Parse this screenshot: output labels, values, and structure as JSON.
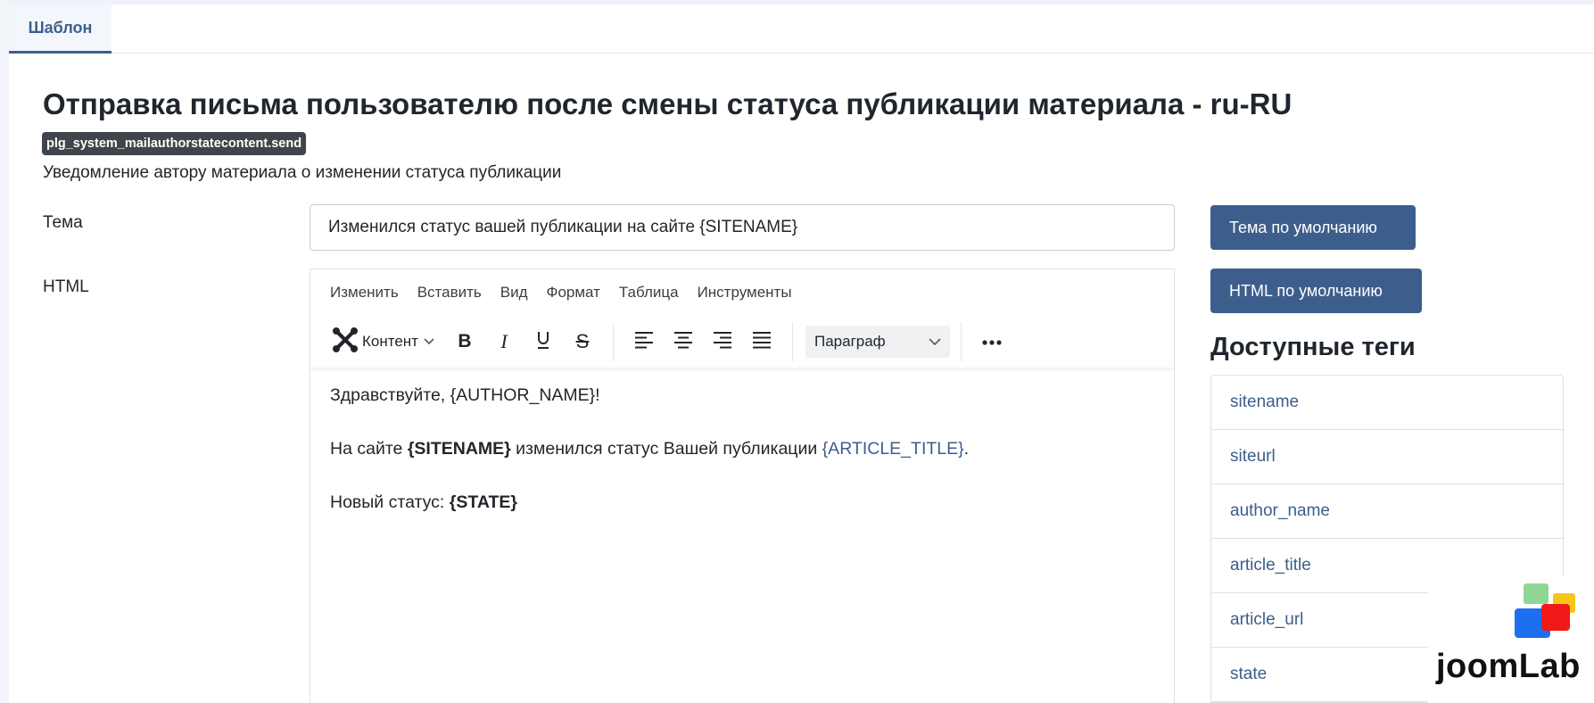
{
  "tabs": [
    {
      "label": "Шаблон"
    }
  ],
  "page": {
    "title": "Отправка письма пользователю после смены статуса публикации материала - ru-RU",
    "code": "plg_system_mailauthorstatecontent.send",
    "description": "Уведомление автору материала о изменении статуса публикации"
  },
  "form": {
    "subject_label": "Тема",
    "subject_value": "Изменился статус вашей публикации на сайте {SITENAME}",
    "html_label": "HTML"
  },
  "editor": {
    "menu": [
      "Изменить",
      "Вставить",
      "Вид",
      "Формат",
      "Таблица",
      "Инструменты"
    ],
    "toolbar": {
      "content_label": "Контент",
      "paragraph_label": "Параграф",
      "icons": [
        "joomla-icon",
        "chevron-down-icon",
        "bold-icon",
        "italic-icon",
        "underline-icon",
        "strikethrough-icon",
        "align-left-icon",
        "align-center-icon",
        "align-right-icon",
        "align-justify-icon",
        "more-icon"
      ]
    },
    "body": {
      "line1": "Здравствуйте, {AUTHOR_NAME}!",
      "line2_pre": "На сайте ",
      "line2_bold": "{SITENAME}",
      "line2_mid": " изменился статус Вашей публикации ",
      "line2_link": "{ARTICLE_TITLE}",
      "line2_end": ".",
      "line3_pre": "Новый статус: ",
      "line3_bold": "{STATE}"
    }
  },
  "sidebar": {
    "default_subject_button": "Тема по умолчанию",
    "default_html_button": "HTML по умолчанию",
    "tags_title": "Доступные теги",
    "tags": [
      "sitename",
      "siteurl",
      "author_name",
      "article_title",
      "article_url",
      "state"
    ]
  },
  "logo": {
    "text": "joomLab",
    "colors": [
      "#8fd694",
      "#f5c518",
      "#1e6ff0",
      "#f01818"
    ]
  },
  "colors": {
    "primary": "#3d5e8c",
    "badge": "#3f454c",
    "text": "#22262a"
  }
}
